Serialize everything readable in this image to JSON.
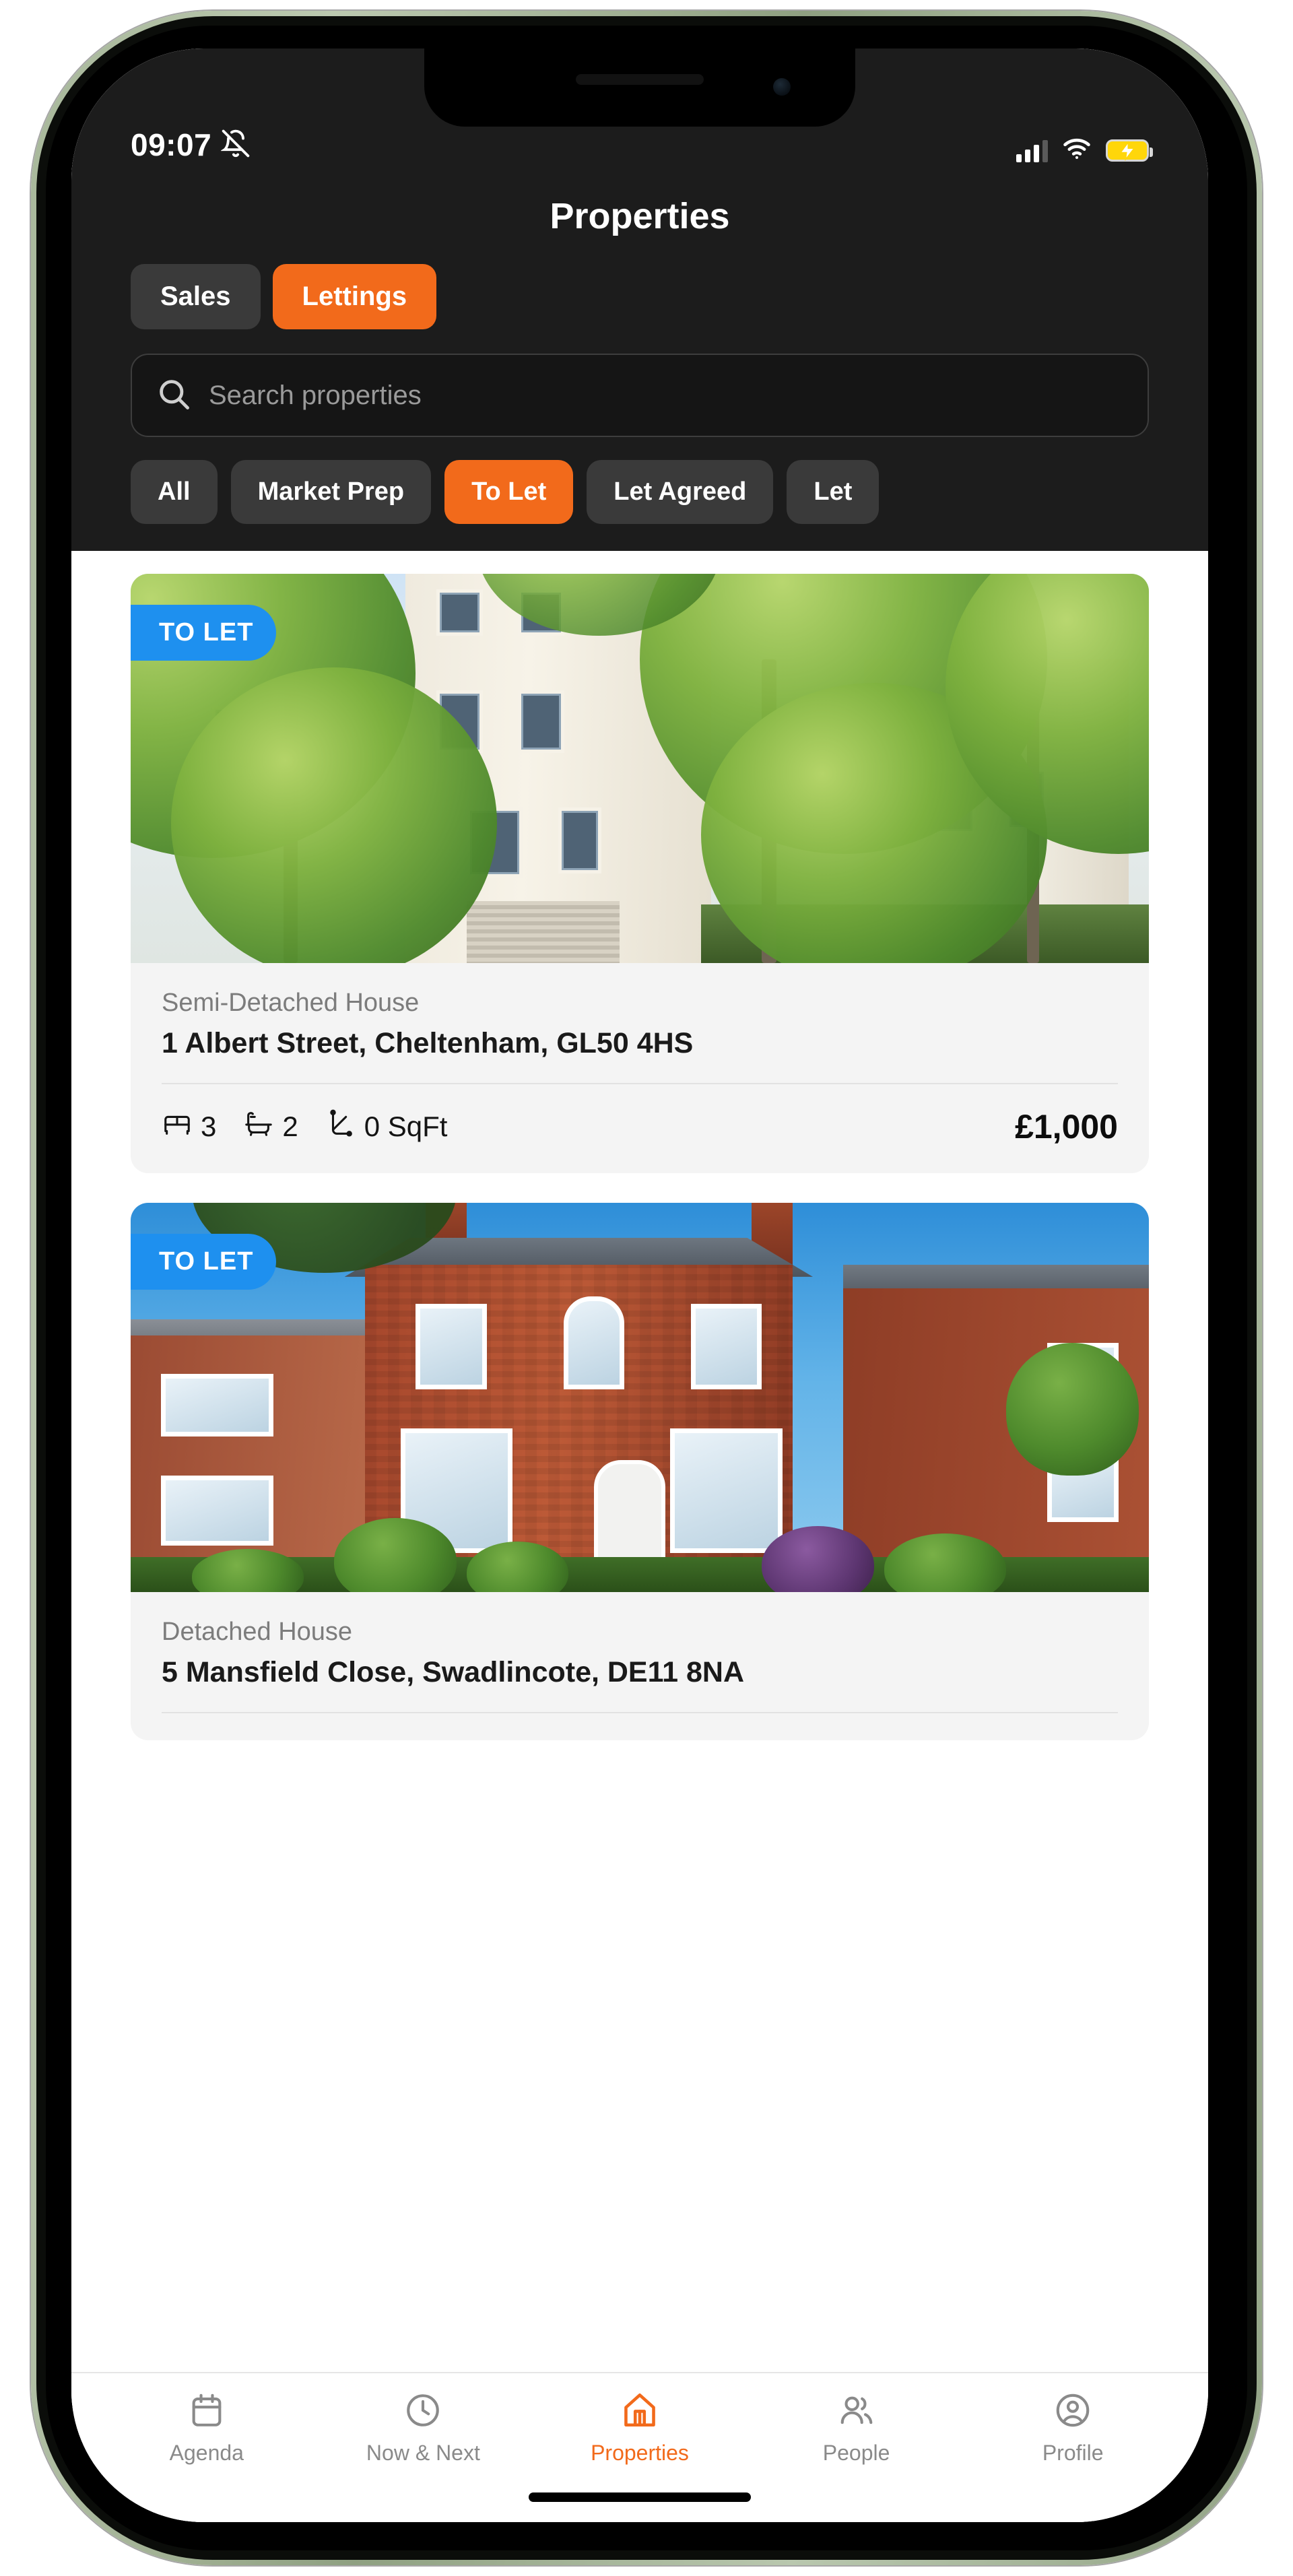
{
  "status_bar": {
    "time": "09:07",
    "silent_icon": "bell-slash-icon",
    "signal_icon": "cellular-signal-icon",
    "signal_bars": 3,
    "wifi_icon": "wifi-icon",
    "battery_icon": "battery-charging-icon",
    "battery_color": "#FFD60A"
  },
  "header": {
    "title": "Properties",
    "accent_color": "#F26A1B",
    "background_color": "#1C1C1C",
    "segments": [
      {
        "label": "Sales",
        "active": false
      },
      {
        "label": "Lettings",
        "active": true
      }
    ],
    "search": {
      "placeholder": "Search properties",
      "value": "",
      "icon": "search-icon"
    },
    "filters": [
      {
        "label": "All",
        "active": false
      },
      {
        "label": "Market Prep",
        "active": false
      },
      {
        "label": "To Let",
        "active": true
      },
      {
        "label": "Let Agreed",
        "active": false
      },
      {
        "label": "Let",
        "active": false,
        "truncated": true
      }
    ]
  },
  "properties": [
    {
      "badge": "TO LET",
      "badge_color": "#1E90EF",
      "type": "Semi-Detached House",
      "address": "1 Albert Street, Cheltenham, GL50 4HS",
      "bedrooms": "3",
      "bathrooms": "2",
      "area": "0 SqFt",
      "price": "£1,000",
      "bed_icon": "bed-icon",
      "bath_icon": "bathtub-icon",
      "area_icon": "ruler-icon",
      "photo": "cream-georgian-townhouse-with-trees"
    },
    {
      "badge": "TO LET",
      "badge_color": "#1E90EF",
      "type": "Detached House",
      "address": "5 Mansfield Close, Swadlincote, DE11 8NA",
      "bedrooms": "",
      "bathrooms": "",
      "area": "",
      "price": "",
      "photo": "red-brick-victorian-detached-house"
    }
  ],
  "tab_bar": {
    "active_color": "#F26A1B",
    "inactive_color": "#8A8A8A",
    "tabs": [
      {
        "label": "Agenda",
        "icon": "calendar-icon",
        "active": false
      },
      {
        "label": "Now & Next",
        "icon": "clock-icon",
        "active": false
      },
      {
        "label": "Properties",
        "icon": "house-icon",
        "active": true
      },
      {
        "label": "People",
        "icon": "people-icon",
        "active": false
      },
      {
        "label": "Profile",
        "icon": "user-circle-icon",
        "active": false
      }
    ]
  }
}
